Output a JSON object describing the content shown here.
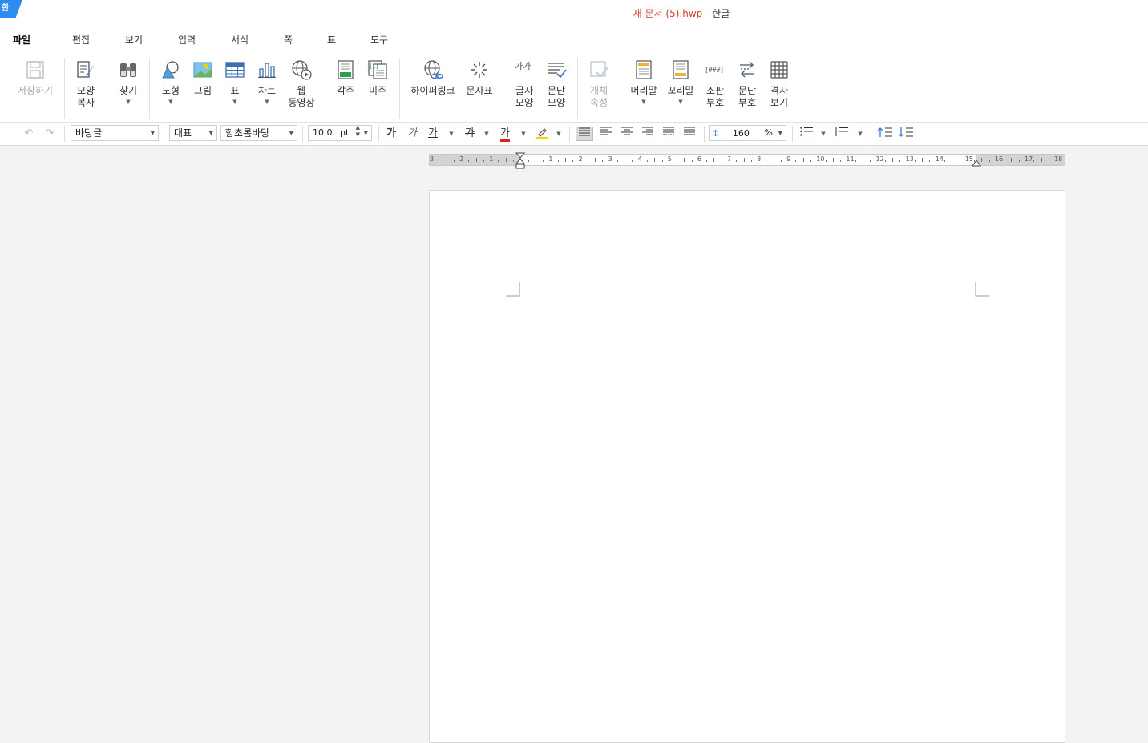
{
  "titlebar": {
    "badge": "한",
    "doc_name": "새 문서 (5).hwp",
    "app_suffix": " - 한글"
  },
  "menu": [
    {
      "label": "파일",
      "active": true
    },
    {
      "label": "편집"
    },
    {
      "label": "보기"
    },
    {
      "label": "입력"
    },
    {
      "label": "서식"
    },
    {
      "label": "쪽"
    },
    {
      "label": "표"
    },
    {
      "label": "도구"
    }
  ],
  "ribbon": {
    "save": {
      "label": "저장하기",
      "icon": "save-icon",
      "disabled": true
    },
    "format_copy": {
      "l1": "모양",
      "l2": "복사",
      "icon": "format-painter-icon"
    },
    "find": {
      "label": "찾기",
      "icon": "binoculars-icon"
    },
    "shape": {
      "label": "도형",
      "icon": "shapes-icon"
    },
    "picture": {
      "label": "그림",
      "icon": "picture-icon"
    },
    "table": {
      "label": "표",
      "icon": "table-icon"
    },
    "chart": {
      "label": "차트",
      "icon": "chart-icon"
    },
    "web_video": {
      "l1": "웹",
      "l2": "동영상",
      "icon": "web-video-icon"
    },
    "footnote": {
      "label": "각주",
      "icon": "footnote-icon"
    },
    "endnote": {
      "label": "미주",
      "icon": "endnote-icon",
      "icon_text": "[1]"
    },
    "hyperlink": {
      "label": "하이퍼링크",
      "icon": "hyperlink-icon"
    },
    "symbols": {
      "label": "문자표",
      "icon": "symbol-icon"
    },
    "char_shape": {
      "l1": "글자",
      "l2": "모양",
      "icon": "char-shape-icon",
      "icon_text": "가가"
    },
    "para_shape": {
      "l1": "문단",
      "l2": "모양",
      "icon": "para-shape-icon"
    },
    "obj_props": {
      "l1": "개체",
      "l2": "속성",
      "icon": "object-properties-icon",
      "disabled": true
    },
    "header": {
      "label": "머리말",
      "icon": "header-icon"
    },
    "footer": {
      "label": "꼬리말",
      "icon": "footer-icon"
    },
    "compose_mark": {
      "l1": "조판",
      "l2": "부호",
      "icon": "compose-mark-icon",
      "icon_text": "[###]"
    },
    "para_mark": {
      "l1": "문단",
      "l2": "부호",
      "icon": "paragraph-mark-icon"
    },
    "grid_view": {
      "l1": "격자",
      "l2": "보기",
      "icon": "grid-icon"
    }
  },
  "format": {
    "style": "바탕글",
    "lang": "대표",
    "font": "함초롬바탕",
    "size": "10.0",
    "size_unit": "pt",
    "bold_label": "가",
    "italic_label": "가",
    "underline_label": "가",
    "strike_label": "가",
    "color_label": "가",
    "font_color": "#e02020",
    "highlight_color": "#f5d400",
    "line_spacing": "160",
    "line_spacing_unit": "%"
  },
  "ruler": {
    "numbers": [
      "3",
      "2",
      "1",
      "",
      "1",
      "2",
      "3",
      "4",
      "5",
      "6",
      "7",
      "8",
      "9",
      "10",
      "11",
      "12",
      "13",
      "14",
      "15",
      "16",
      "17",
      "18"
    ]
  }
}
